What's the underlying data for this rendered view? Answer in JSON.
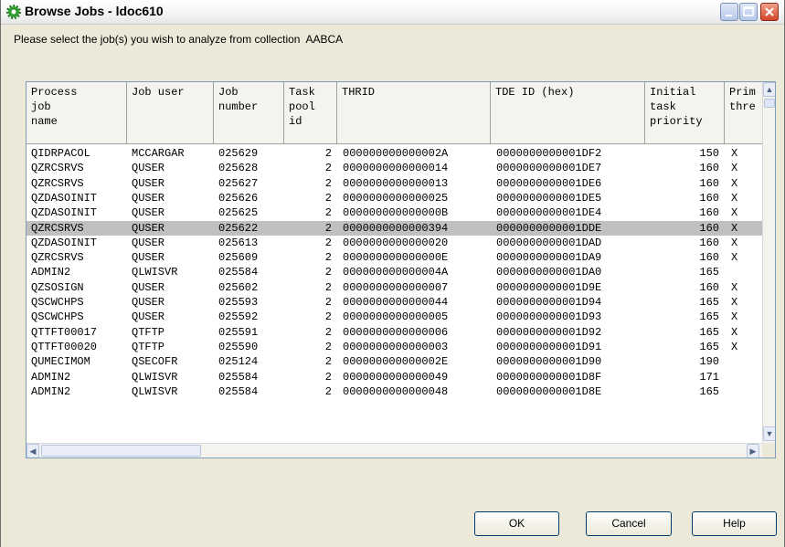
{
  "window": {
    "title": "Browse Jobs - ldoc610",
    "icon": "green-gear-icon"
  },
  "prompt": "Please select the job(s) you wish to analyze from collection  AABCA",
  "table": {
    "headers": [
      "Process\njob\nname",
      "Job user",
      "Job\nnumber",
      "Task\npool\nid",
      "THRID",
      "TDE ID (hex)",
      "Initial\ntask\npriority",
      "Prim\nthre"
    ],
    "rows": [
      [
        "QIDRPACOL",
        "MCCARGAR",
        "025629",
        "2",
        "000000000000002A",
        "0000000000001DF2",
        "150",
        "X"
      ],
      [
        "QZRCSRVS",
        "QUSER",
        "025628",
        "2",
        "0000000000000014",
        "0000000000001DE7",
        "160",
        "X"
      ],
      [
        "QZRCSRVS",
        "QUSER",
        "025627",
        "2",
        "0000000000000013",
        "0000000000001DE6",
        "160",
        "X"
      ],
      [
        "QZDASOINIT",
        "QUSER",
        "025626",
        "2",
        "0000000000000025",
        "0000000000001DE5",
        "160",
        "X"
      ],
      [
        "QZDASOINIT",
        "QUSER",
        "025625",
        "2",
        "000000000000000B",
        "0000000000001DE4",
        "160",
        "X"
      ],
      [
        "QZRCSRVS",
        "QUSER",
        "025622",
        "2",
        "0000000000000394",
        "0000000000001DDE",
        "160",
        "X"
      ],
      [
        "QZDASOINIT",
        "QUSER",
        "025613",
        "2",
        "0000000000000020",
        "0000000000001DAD",
        "160",
        "X"
      ],
      [
        "QZRCSRVS",
        "QUSER",
        "025609",
        "2",
        "000000000000000E",
        "0000000000001DA9",
        "160",
        "X"
      ],
      [
        "ADMIN2",
        "QLWISVR",
        "025584",
        "2",
        "000000000000004A",
        "0000000000001DA0",
        "165",
        ""
      ],
      [
        "QZSOSIGN",
        "QUSER",
        "025602",
        "2",
        "0000000000000007",
        "0000000000001D9E",
        "160",
        "X"
      ],
      [
        "QSCWCHPS",
        "QUSER",
        "025593",
        "2",
        "0000000000000044",
        "0000000000001D94",
        "165",
        "X"
      ],
      [
        "QSCWCHPS",
        "QUSER",
        "025592",
        "2",
        "0000000000000005",
        "0000000000001D93",
        "165",
        "X"
      ],
      [
        "QTTFT00017",
        "QTFTP",
        "025591",
        "2",
        "0000000000000006",
        "0000000000001D92",
        "165",
        "X"
      ],
      [
        "QTTFT00020",
        "QTFTP",
        "025590",
        "2",
        "0000000000000003",
        "0000000000001D91",
        "165",
        "X"
      ],
      [
        "QUMECIMOM",
        "QSECOFR",
        "025124",
        "2",
        "000000000000002E",
        "0000000000001D90",
        "190",
        ""
      ],
      [
        "ADMIN2",
        "QLWISVR",
        "025584",
        "2",
        "0000000000000049",
        "0000000000001D8F",
        "171",
        ""
      ],
      [
        "ADMIN2",
        "QLWISVR",
        "025584",
        "2",
        "0000000000000048",
        "0000000000001D8E",
        "165",
        ""
      ]
    ],
    "selected_row": 5
  },
  "buttons": {
    "ok": "OK",
    "cancel": "Cancel",
    "help": "Help"
  },
  "colors": {
    "dialog_bg": "#ECE9D8",
    "selection": "#C0C0C0",
    "close_button": "#D2462B",
    "icon_green": "#2E9B2E"
  }
}
